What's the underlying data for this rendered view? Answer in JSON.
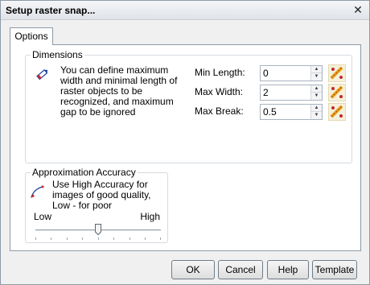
{
  "window": {
    "title": "Setup raster snap...",
    "close_label": "✕"
  },
  "tabs": [
    {
      "label": "Options"
    }
  ],
  "dimensions": {
    "caption": "Dimensions",
    "description": "You can define maximum width and minimal length of raster objects to be recognized, and maximum gap to be ignored",
    "params": [
      {
        "label": "Min Length:",
        "value": "0"
      },
      {
        "label": "Max Width:",
        "value": "2"
      },
      {
        "label": "Max Break:",
        "value": "0.5"
      }
    ]
  },
  "accuracy": {
    "caption": "Approximation Accuracy",
    "description": "Use High Accuracy  for images of good quality, Low - for poor",
    "low_label": "Low",
    "high_label": "High",
    "level": 0.5
  },
  "buttons": {
    "ok": "OK",
    "cancel": "Cancel",
    "help": "Help",
    "template": "Template"
  },
  "colors": {
    "accent_pencil": "#1a3fa0",
    "pencil_tip": "#c62828",
    "pick_icon": "#e3a018"
  }
}
